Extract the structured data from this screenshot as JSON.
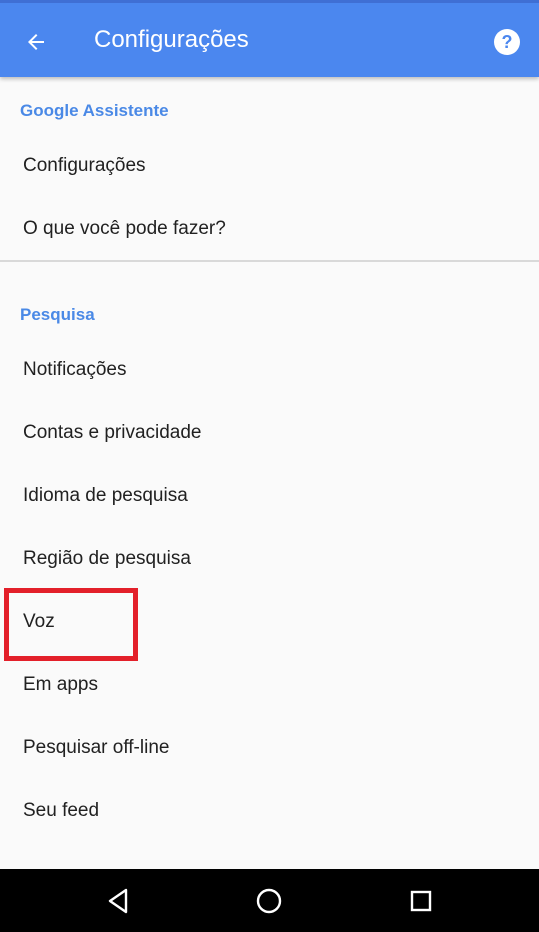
{
  "appbar": {
    "title": "Configurações",
    "back_icon": "arrow-back-icon",
    "help_icon": "help-circle-icon",
    "color": "#4b87ef"
  },
  "sections": [
    {
      "header": "Google Assistente",
      "items": [
        {
          "label": "Configurações"
        },
        {
          "label": "O que você pode fazer?"
        }
      ]
    },
    {
      "header": "Pesquisa",
      "items": [
        {
          "label": "Notificações"
        },
        {
          "label": "Contas e privacidade"
        },
        {
          "label": "Idioma de pesquisa"
        },
        {
          "label": "Região de pesquisa"
        },
        {
          "label": "Voz"
        },
        {
          "label": "Em apps"
        },
        {
          "label": "Pesquisar off-line"
        },
        {
          "label": "Seu feed"
        }
      ]
    }
  ],
  "highlight": {
    "target": "Voz",
    "color": "#e3202a"
  },
  "navbar": {
    "buttons": [
      "back-triangle-icon",
      "home-circle-icon",
      "recents-square-icon"
    ]
  }
}
